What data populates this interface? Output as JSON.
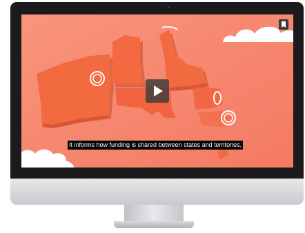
{
  "video": {
    "subtitle": "It informs how funding is shared between states and territories,",
    "play_icon": "play-icon",
    "corner_icon": "bookmark-icon",
    "background_color": "#f7826b",
    "map_color": "#f26a3f"
  }
}
